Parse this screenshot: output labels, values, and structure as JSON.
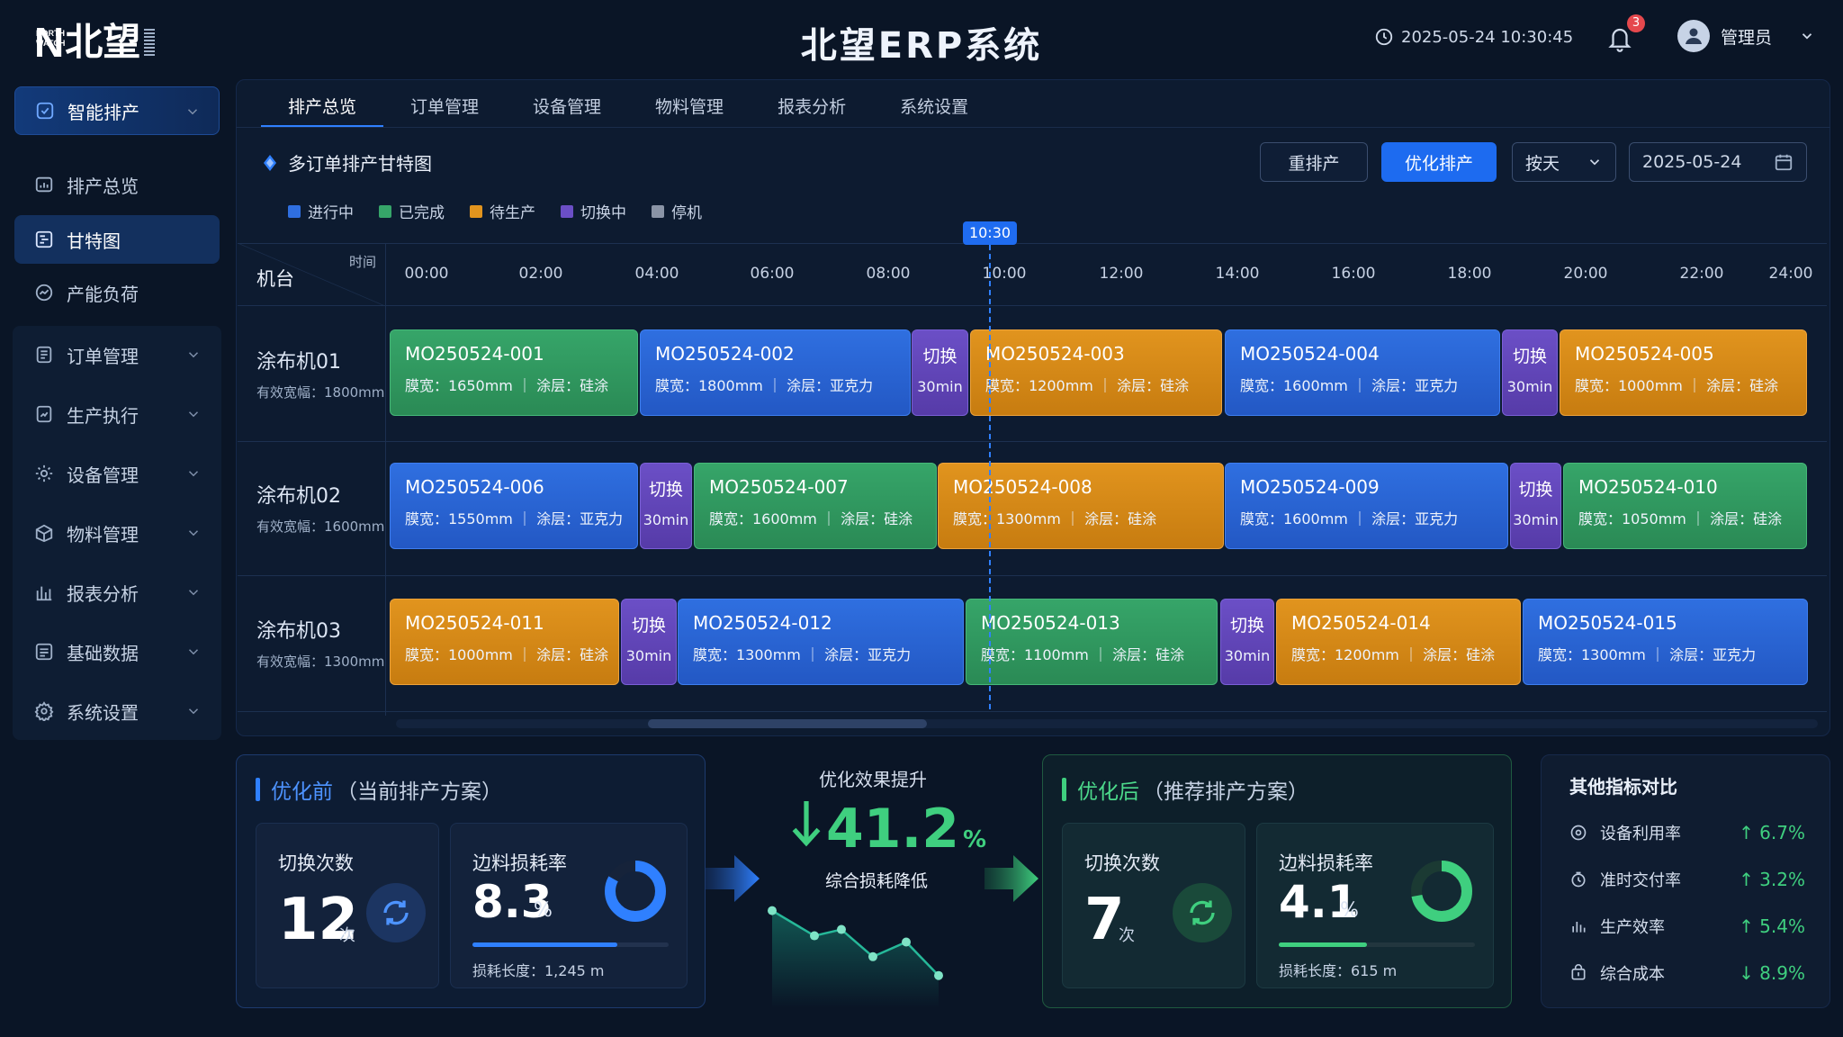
{
  "app": {
    "title": "北望ERP系统",
    "logo_small": "NORTH WATCH",
    "logo_letter": "N",
    "logo_cn": "北望"
  },
  "header": {
    "datetime": "2025-05-24 10:30:45",
    "notifications": "3",
    "user": "管理员"
  },
  "sidebar": {
    "top": "智能排产",
    "sub": [
      "排产总览",
      "甘特图",
      "产能负荷"
    ],
    "groups": [
      "订单管理",
      "生产执行",
      "设备管理",
      "物料管理",
      "报表分析",
      "基础数据",
      "系统设置"
    ]
  },
  "tabs": [
    "排产总览",
    "订单管理",
    "设备管理",
    "物料管理",
    "报表分析",
    "系统设置"
  ],
  "gantt": {
    "title": "多订单排产甘特图",
    "buttons": {
      "reschedule": "重排产",
      "optimize": "优化排产"
    },
    "view_select": "按天",
    "date": "2025-05-24",
    "legend": [
      {
        "label": "进行中",
        "color": "#2f6fe0"
      },
      {
        "label": "已完成",
        "color": "#36a569"
      },
      {
        "label": "待生产",
        "color": "#e1941e"
      },
      {
        "label": "切换中",
        "color": "#6b4fc6"
      },
      {
        "label": "停机",
        "color": "#8a94a6"
      }
    ],
    "col_time": "时间",
    "col_machine": "机台",
    "ticks": [
      "00:00",
      "02:00",
      "04:00",
      "06:00",
      "08:00",
      "10:00",
      "12:00",
      "14:00",
      "16:00",
      "18:00",
      "20:00",
      "22:00",
      "24:00"
    ],
    "now": "10:30",
    "machines": [
      {
        "name": "涂布机01",
        "width": "有效宽幅：1800mm"
      },
      {
        "name": "涂布机02",
        "width": "有效宽幅：1600mm"
      },
      {
        "name": "涂布机03",
        "width": "有效宽幅：1300mm"
      }
    ],
    "bars": [
      [
        {
          "id": "MO250524-001",
          "info": "膜宽：1650mm ｜ 涂层：硅涂",
          "color": "green"
        },
        {
          "id": "MO250524-002",
          "info": "膜宽：1800mm ｜ 涂层：亚克力",
          "color": "blue"
        },
        {
          "id": "切换",
          "info": "30min",
          "color": "purple"
        },
        {
          "id": "MO250524-003",
          "info": "膜宽：1200mm ｜ 涂层：硅涂",
          "color": "orange"
        },
        {
          "id": "MO250524-004",
          "info": "膜宽：1600mm ｜ 涂层：亚克力",
          "color": "blue"
        },
        {
          "id": "切换",
          "info": "30min",
          "color": "purple"
        },
        {
          "id": "MO250524-005",
          "info": "膜宽：1000mm ｜ 涂层：硅涂",
          "color": "orange"
        }
      ],
      [
        {
          "id": "MO250524-006",
          "info": "膜宽：1550mm ｜ 涂层：亚克力",
          "color": "blue"
        },
        {
          "id": "切换",
          "info": "30min",
          "color": "purple"
        },
        {
          "id": "MO250524-007",
          "info": "膜宽：1600mm ｜ 涂层：硅涂",
          "color": "green"
        },
        {
          "id": "MO250524-008",
          "info": "膜宽：1300mm ｜ 涂层：硅涂",
          "color": "orange"
        },
        {
          "id": "MO250524-009",
          "info": "膜宽：1600mm ｜ 涂层：亚克力",
          "color": "blue"
        },
        {
          "id": "切换",
          "info": "30min",
          "color": "purple"
        },
        {
          "id": "MO250524-010",
          "info": "膜宽：1050mm ｜ 涂层：硅涂",
          "color": "green"
        }
      ],
      [
        {
          "id": "MO250524-011",
          "info": "膜宽：1000mm ｜ 涂层：硅涂",
          "color": "orange"
        },
        {
          "id": "切换",
          "info": "30min",
          "color": "purple"
        },
        {
          "id": "MO250524-012",
          "info": "膜宽：1300mm ｜ 涂层：亚克力",
          "color": "blue"
        },
        {
          "id": "MO250524-013",
          "info": "膜宽：1100mm ｜ 涂层：硅涂",
          "color": "green"
        },
        {
          "id": "切换",
          "info": "30min",
          "color": "purple"
        },
        {
          "id": "MO250524-014",
          "info": "膜宽：1200mm ｜ 涂层：硅涂",
          "color": "orange"
        },
        {
          "id": "MO250524-015",
          "info": "膜宽：1300mm ｜ 涂层：亚克力",
          "color": "blue"
        }
      ]
    ]
  },
  "before": {
    "title": "优化前",
    "subtitle": "（当前排产方案）",
    "switch_label": "切换次数",
    "switch_value": "12",
    "switch_unit": "次",
    "loss_label": "边料损耗率",
    "loss_value": "8.3",
    "loss_unit": "%",
    "loss_length": "损耗长度：1,245 m",
    "loss_fraction": 0.083
  },
  "improve": {
    "label": "优化效果提升",
    "value": "41.2",
    "unit": "%",
    "sub": "综合损耗降低",
    "trend": [
      8.3,
      7.1,
      7.4,
      6.1,
      6.8,
      5.2
    ]
  },
  "after": {
    "title": "优化后",
    "subtitle": "（推荐排产方案）",
    "switch_label": "切换次数",
    "switch_value": "7",
    "switch_unit": "次",
    "loss_label": "边料损耗率",
    "loss_value": "4.1",
    "loss_unit": "%",
    "loss_length": "损耗长度：615 m",
    "loss_fraction": 0.041
  },
  "other": {
    "title": "其他指标对比",
    "rows": [
      {
        "label": "设备利用率",
        "value": "↑ 6.7%"
      },
      {
        "label": "准时交付率",
        "value": "↑ 3.2%"
      },
      {
        "label": "生产效率",
        "value": "↑ 5.4%"
      },
      {
        "label": "综合成本",
        "value": "↓ 8.9%"
      }
    ]
  },
  "colors": {
    "accent": "#1d6bf0",
    "success": "#3fcf7f",
    "panel": "#0d1b30"
  }
}
